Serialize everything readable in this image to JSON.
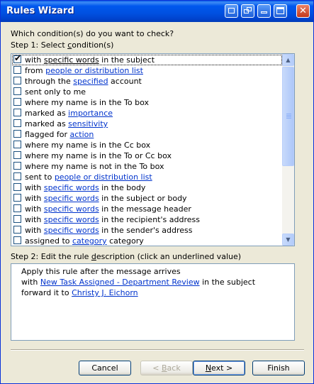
{
  "window": {
    "title": "Rules Wizard",
    "title_buttons": [
      "restore-icon",
      "copy-icon",
      "minimize-icon",
      "maximize-icon"
    ],
    "close_symbol": "✕"
  },
  "prompt": "Which condition(s) do you want to check?",
  "step1": {
    "label_before": "Step 1: Select ",
    "label_key": "c",
    "label_after": "ondition(s)"
  },
  "conditions": [
    {
      "checked": true,
      "selected": true,
      "parts": [
        {
          "t": "with "
        },
        {
          "t": "specific words",
          "u": true
        },
        {
          "t": " in the subject"
        }
      ]
    },
    {
      "checked": false,
      "parts": [
        {
          "t": "from "
        },
        {
          "t": "people or distribution list",
          "link": true
        }
      ]
    },
    {
      "checked": false,
      "parts": [
        {
          "t": "through the "
        },
        {
          "t": "specified",
          "link": true
        },
        {
          "t": " account"
        }
      ]
    },
    {
      "checked": false,
      "parts": [
        {
          "t": "sent only to me"
        }
      ]
    },
    {
      "checked": false,
      "parts": [
        {
          "t": "where my name is in the To box"
        }
      ]
    },
    {
      "checked": false,
      "parts": [
        {
          "t": "marked as "
        },
        {
          "t": "importance",
          "link": true
        }
      ]
    },
    {
      "checked": false,
      "parts": [
        {
          "t": "marked as "
        },
        {
          "t": "sensitivity",
          "link": true
        }
      ]
    },
    {
      "checked": false,
      "parts": [
        {
          "t": "flagged for "
        },
        {
          "t": "action",
          "link": true
        }
      ]
    },
    {
      "checked": false,
      "parts": [
        {
          "t": "where my name is in the Cc box"
        }
      ]
    },
    {
      "checked": false,
      "parts": [
        {
          "t": "where my name is in the To or Cc box"
        }
      ]
    },
    {
      "checked": false,
      "parts": [
        {
          "t": "where my name is not in the To box"
        }
      ]
    },
    {
      "checked": false,
      "parts": [
        {
          "t": "sent to "
        },
        {
          "t": "people or distribution list",
          "link": true
        }
      ]
    },
    {
      "checked": false,
      "parts": [
        {
          "t": "with "
        },
        {
          "t": "specific words",
          "link": true
        },
        {
          "t": " in the body"
        }
      ]
    },
    {
      "checked": false,
      "parts": [
        {
          "t": "with "
        },
        {
          "t": "specific words",
          "link": true
        },
        {
          "t": " in the subject or body"
        }
      ]
    },
    {
      "checked": false,
      "parts": [
        {
          "t": "with "
        },
        {
          "t": "specific words",
          "link": true
        },
        {
          "t": " in the message header"
        }
      ]
    },
    {
      "checked": false,
      "parts": [
        {
          "t": "with "
        },
        {
          "t": "specific words",
          "link": true
        },
        {
          "t": " in the recipient's address"
        }
      ]
    },
    {
      "checked": false,
      "parts": [
        {
          "t": "with "
        },
        {
          "t": "specific words",
          "link": true
        },
        {
          "t": " in the sender's address"
        }
      ]
    },
    {
      "checked": false,
      "parts": [
        {
          "t": "assigned to "
        },
        {
          "t": "category",
          "link": true
        },
        {
          "t": " category"
        }
      ]
    }
  ],
  "scrollbar": {
    "up_symbol": "▲",
    "down_symbol": "▼"
  },
  "step2": {
    "label_before": "Step 2: Edit the rule ",
    "label_key": "d",
    "label_after": "escription (click an underlined value)"
  },
  "description": [
    [
      {
        "t": "Apply this rule after the message arrives"
      }
    ],
    [
      {
        "t": "with "
      },
      {
        "t": "New Task Assigned - Department Review",
        "link": true
      },
      {
        "t": " in the subject"
      }
    ],
    [
      {
        "t": "forward it to "
      },
      {
        "t": "Christy J. Eichorn",
        "link": true
      }
    ]
  ],
  "buttons": {
    "cancel": "Cancel",
    "back_prefix": "< ",
    "back_key": "B",
    "back_rest": "ack",
    "next_key": "N",
    "next_rest": "ext >",
    "finish": "Finish"
  }
}
